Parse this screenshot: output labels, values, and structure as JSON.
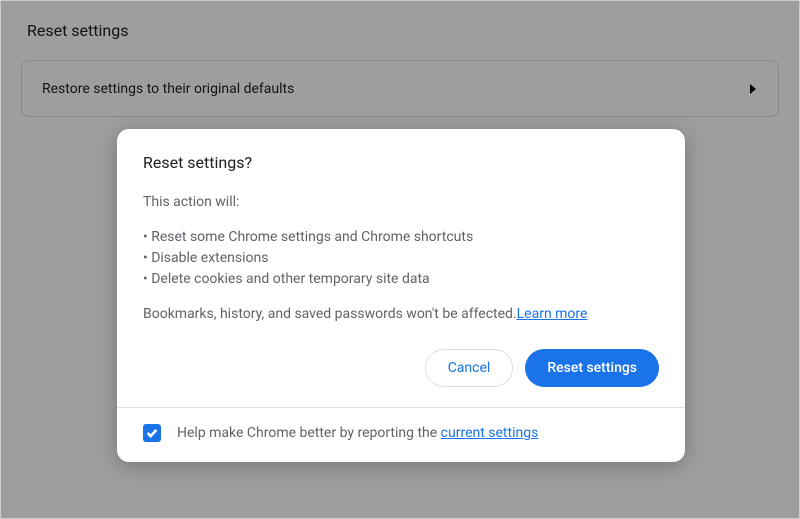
{
  "page": {
    "section_title": "Reset settings",
    "restore_row_label": "Restore settings to their original defaults"
  },
  "dialog": {
    "title": "Reset settings?",
    "intro": "This action will:",
    "bullets": [
      "Reset some Chrome settings and Chrome shortcuts",
      "Disable extensions",
      "Delete cookies and other temporary site data"
    ],
    "note_prefix": "Bookmarks, history, and saved passwords won't be affected.",
    "learn_more": "Learn more",
    "cancel_label": "Cancel",
    "confirm_label": "Reset settings",
    "footer_text_prefix": "Help make Chrome better by reporting the ",
    "footer_link": "current settings"
  }
}
